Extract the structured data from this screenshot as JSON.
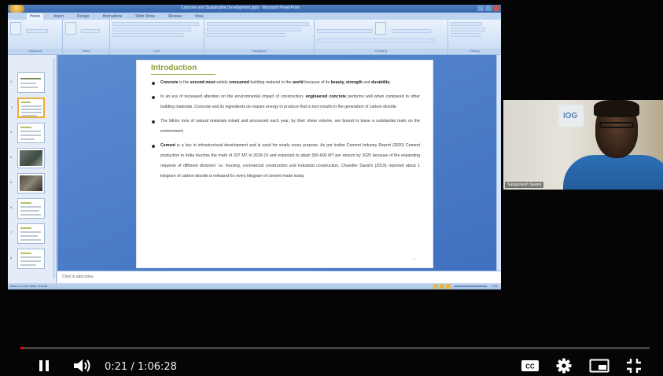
{
  "powerpoint": {
    "window_title": "Concrete and Sustainable Development.pptx - Microsoft PowerPoint",
    "ribbon_tabs": [
      "Home",
      "Insert",
      "Design",
      "Animations",
      "Slide Show",
      "Review",
      "View"
    ],
    "ribbon_groups": [
      "Clipboard",
      "Slides",
      "Font",
      "Paragraph",
      "Drawing",
      "Editing"
    ],
    "thumbnail_numbers": [
      "1",
      "2",
      "3",
      "4",
      "5",
      "6",
      "7",
      "8"
    ],
    "notes_placeholder": "Click to add notes",
    "status_left": "Slide 2 of 30    Office Theme",
    "status_zoom": "73%"
  },
  "slide": {
    "title": "Introduction",
    "bullets": [
      {
        "parts": [
          {
            "t": "Concrete",
            "b": true
          },
          {
            "t": " is the ",
            "b": false
          },
          {
            "t": "second most",
            "b": true
          },
          {
            "t": " widely ",
            "b": false
          },
          {
            "t": "consumed",
            "b": true
          },
          {
            "t": " building material in the ",
            "b": false
          },
          {
            "t": "world",
            "b": true
          },
          {
            "t": " because of its ",
            "b": false
          },
          {
            "t": "beauty, strength",
            "b": true
          },
          {
            "t": " and ",
            "b": false
          },
          {
            "t": "durability",
            "b": true
          },
          {
            "t": ".",
            "b": false
          }
        ]
      },
      {
        "parts": [
          {
            "t": "In an era of increased attention on the environmental impact of construction, ",
            "b": false
          },
          {
            "t": "engineered concrete",
            "b": true
          },
          {
            "t": " performs well when compared to other building materials. Concrete and its ingredients do require energy to produce that in turn results in the generation of carbon dioxide.",
            "b": false
          }
        ]
      },
      {
        "parts": [
          {
            "t": "The billion tons of natural materials mined and processed each year, by their sheer volume, are bound to leave a substantial mark on the environment.",
            "b": false
          }
        ]
      },
      {
        "parts": [
          {
            "t": "Cement",
            "b": true
          },
          {
            "t": " is a key to infrastructural development and is used for nearly every purpose. As per Indian Cement Industry Report (2020) Cement production in India touches the mark of 337 MT in 2018-19 and expected to attain 550-600 MT per annum by 2025 because of the expanding requests of different divisions' i.e. housing, commercial construction and industrial construction. Chandler David's (2019) reported about 1 kilogram of carbon dioxide is released for every kilogram of cement made today.",
            "b": false
          }
        ]
      }
    ],
    "slide_number": "2"
  },
  "webcam": {
    "logo_text": "IOG",
    "participant_name": "Sangamesh Swami"
  },
  "player": {
    "time_current": "0:21",
    "time_total": "1:06:28",
    "time_display": "0:21 / 1:06:28",
    "progress_fraction": 0.0053,
    "progress_color": "#ff0000"
  }
}
